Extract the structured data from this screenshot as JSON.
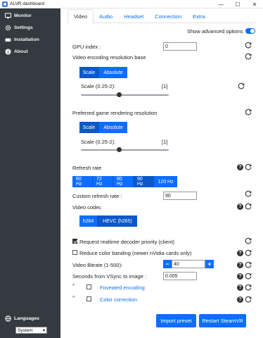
{
  "window": {
    "title": "ALVR dashboard",
    "minimize": "—",
    "maximize": "☐",
    "close": "✕"
  },
  "sidebar": {
    "items": [
      {
        "label": "Monitor",
        "icon": "monitor-icon"
      },
      {
        "label": "Settings",
        "icon": "gear-icon"
      },
      {
        "label": "Installation",
        "icon": "hdd-icon"
      },
      {
        "label": "About",
        "icon": "info-icon"
      }
    ],
    "languages_label": "Languages",
    "language_value": "System"
  },
  "tabs": [
    "Video",
    "Audio",
    "Headset",
    "Connection",
    "Extra"
  ],
  "active_tab": "Video",
  "advanced": {
    "label": "Show advanced options",
    "on": true
  },
  "video": {
    "gpu_index": {
      "label": "GPU index :",
      "value": "0"
    },
    "encoding_res": {
      "label": "Video encoding resolution base",
      "options": [
        "Scale",
        "Absolute"
      ],
      "selected": "Scale",
      "scale_label": "Scale (0.25-2):",
      "scale_value": "[1]",
      "slider_fraction": 0.43
    },
    "render_res": {
      "label": "Preferred game rendering resolution",
      "options": [
        "Scale",
        "Absolute"
      ],
      "selected": "Scale",
      "scale_label": "Scale (0.25-2):",
      "scale_value": "[1]",
      "slider_fraction": 0.43
    },
    "refresh": {
      "label": "Refresh rate",
      "options": [
        "60 Hz",
        "72 Hz",
        "80 Hz",
        "90 Hz",
        "120 Hz"
      ],
      "selected": "90 Hz"
    },
    "custom_refresh": {
      "label": "Custom refresh rate :",
      "value": "90"
    },
    "codec": {
      "label": "Video codec",
      "options": [
        "h264",
        "HEVC (h265)"
      ],
      "selected": "HEVC (h265)"
    },
    "realtime": {
      "label": "Request realtime decoder priority (client)",
      "checked": true
    },
    "banding": {
      "label": "Reduce color banding (newer nVidia cards only)",
      "checked": false
    },
    "bitrate": {
      "label": "Video Bitrate (1-500):",
      "value": "40",
      "minus": "−",
      "plus": "+"
    },
    "vsync": {
      "label": "Seconds from VSync to image :",
      "value": "0.005"
    },
    "foveated": {
      "label": "Foveated encoding",
      "checked": false
    },
    "color_correction": {
      "label": "Color correction",
      "checked": false
    }
  },
  "actions": {
    "import_preset": "Import preset",
    "restart_steamvr": "Restart SteamVR"
  },
  "help_glyph": "?",
  "caret_glyph": "^"
}
